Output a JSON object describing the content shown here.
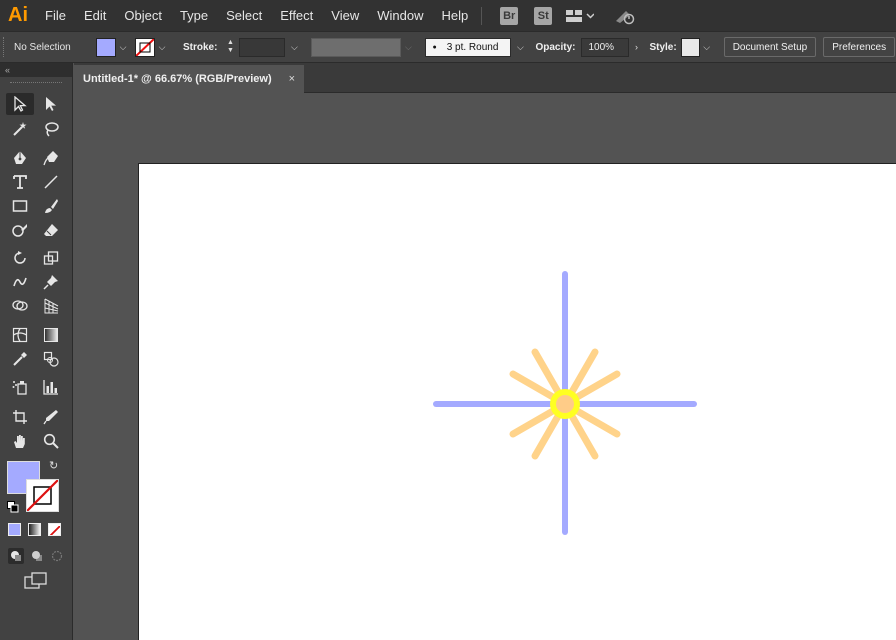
{
  "app": {
    "logo": "Ai",
    "menu": [
      "File",
      "Edit",
      "Object",
      "Type",
      "Select",
      "Effect",
      "View",
      "Window",
      "Help"
    ],
    "bridge_badge": "Br",
    "stock_badge": "St",
    "workspace_icon": "arrange-documents-icon",
    "sync_icon": "creative-cloud-sync-icon"
  },
  "control_bar": {
    "selection_status": "No Selection",
    "fill_color": "#a4aaff",
    "stroke_swatch": "none",
    "stroke_label": "Stroke:",
    "brush_label": "3 pt. Round",
    "opacity_label": "Opacity:",
    "opacity_value": "100%",
    "style_label": "Style:",
    "document_setup": "Document Setup",
    "preferences": "Preferences"
  },
  "document": {
    "tab_title": "Untitled-1* @ 66.67% (RGB/Preview)",
    "tab_close": "×"
  },
  "artwork": {
    "cross_color": "#a4aaff",
    "ray_color": "#ffd38a",
    "ring_color": "#ffff22",
    "center_color": "#ffcc88"
  },
  "colors": {
    "menubar_bg": "#323232",
    "panel_bg": "#424242",
    "canvas_bg": "#535353",
    "artboard_bg": "#ffffff"
  }
}
